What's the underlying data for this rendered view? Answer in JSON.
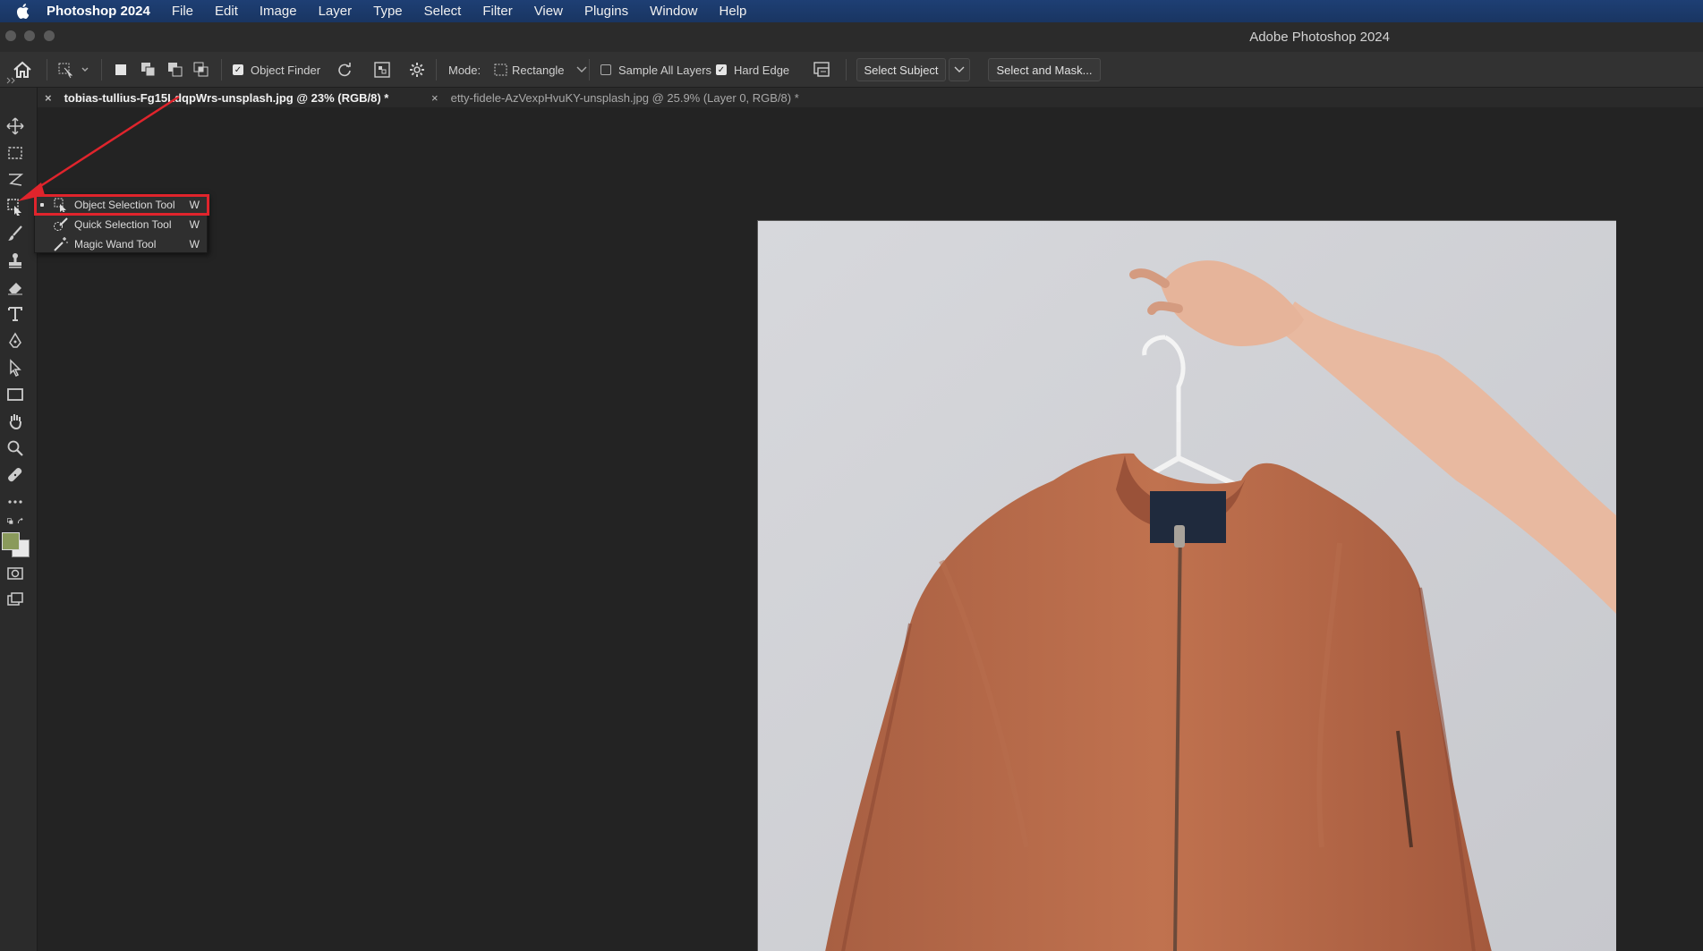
{
  "menubar": {
    "app_name": "Photoshop 2024",
    "items": [
      "File",
      "Edit",
      "Image",
      "Layer",
      "Type",
      "Select",
      "Filter",
      "View",
      "Plugins",
      "Window",
      "Help"
    ]
  },
  "window": {
    "title": "Adobe Photoshop 2024"
  },
  "options": {
    "object_finder_label": "Object Finder",
    "object_finder_checked": true,
    "mode_label": "Mode:",
    "mode_value": "Rectangle",
    "sample_all_layers_label": "Sample All Layers",
    "sample_all_layers_checked": false,
    "hard_edge_label": "Hard Edge",
    "hard_edge_checked": true,
    "select_subject_label": "Select Subject",
    "select_and_mask_label": "Select and Mask..."
  },
  "tabs": [
    {
      "label": "tobias-tullius-Fg15LdqpWrs-unsplash.jpg @ 23% (RGB/8) *",
      "active": true
    },
    {
      "label": "etty-fidele-AzVexpHvuKY-unsplash.jpg @ 25.9% (Layer 0, RGB/8) *",
      "active": false
    }
  ],
  "flyout": {
    "items": [
      {
        "label": "Object Selection Tool",
        "shortcut": "W",
        "icon": "object-selection-icon",
        "selected": true
      },
      {
        "label": "Quick Selection Tool",
        "shortcut": "W",
        "icon": "quick-selection-icon",
        "selected": false
      },
      {
        "label": "Magic Wand Tool",
        "shortcut": "W",
        "icon": "magic-wand-icon",
        "selected": false
      }
    ]
  },
  "colors": {
    "annotation_red": "#e0242c",
    "foreground_swatch": "#8a9a5b",
    "background_swatch": "#e8e8e8",
    "jacket": "#b5694a"
  }
}
